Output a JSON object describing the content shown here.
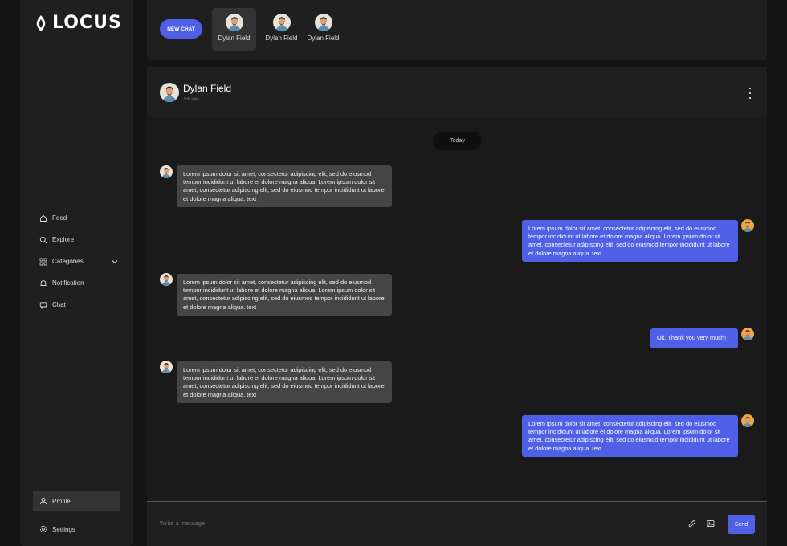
{
  "brand": {
    "name": "LOCUS"
  },
  "sidebar": {
    "items": [
      {
        "label": "Feed",
        "icon": "home-icon"
      },
      {
        "label": "Explore",
        "icon": "search-icon"
      },
      {
        "label": "Categories",
        "icon": "grid-icon"
      },
      {
        "label": "Notification",
        "icon": "bell-icon"
      },
      {
        "label": "Chat",
        "icon": "chat-icon"
      }
    ],
    "profile": "Profile",
    "settings": "Settings"
  },
  "topbar": {
    "new_chat": "NEW CHAT",
    "contacts": [
      "Dylan Field",
      "Dylan Field",
      "Dylan Field"
    ]
  },
  "chat": {
    "name": "Dylan Field",
    "role": "Job role",
    "date_divider": "Today",
    "messages": [
      {
        "side": "in",
        "text": "Lorem ipsum dolor sit amet, consectetur adipiscing elit, sed do eiusmod tempor incididunt ut labore et dolore magna aliqua. Lorem ipsum dolor sit amet, consectetur adipiscing elit, sed do eiusmod tempor incididunt ut labore et dolore magna aliqua. text"
      },
      {
        "side": "out",
        "text": "Lorem ipsum dolor sit amet, consectetur adipiscing elit, sed do eiusmod tempor incididunt ut labore et dolore magna aliqua. Lorem ipsum dolor sit amet, consectetur adipiscing elit, sed do eiusmod tempor incididunt ut labore et dolore magna aliqua. text"
      },
      {
        "side": "in",
        "text": "Lorem ipsum dolor sit amet, consectetur adipiscing elit, sed do eiusmod tempor incididunt ut labore et dolore magna aliqua. Lorem ipsum dolor sit amet, consectetur adipiscing elit, sed do eiusmod tempor incididunt ut labore et dolore magna aliqua. text"
      },
      {
        "side": "out",
        "text": "Ok. Thank you very much!"
      },
      {
        "side": "in",
        "text": "Lorem ipsum dolor sit amet, consectetur adipiscing elit, sed do eiusmod tempor incididunt ut labore et dolore magna aliqua. Lorem ipsum dolor sit amet, consectetur adipiscing elit, sed do eiusmod tempor incididunt ut labore et dolore magna aliqua. text"
      },
      {
        "side": "out",
        "text": "Lorem ipsum dolor sit amet, consectetur adipiscing elit, sed do eiusmod tempor incididunt ut labore et dolore magna aliqua. Lorem ipsum dolor sit amet, consectetur adipiscing elit, sed do eiusmod tempor incididunt ut labore et dolore magna aliqua. text"
      }
    ],
    "composer_placeholder": "Write a message",
    "send_label": "Send"
  },
  "colors": {
    "accent": "#4f5fe6",
    "panel": "#1f1f1f",
    "incoming": "#454545"
  }
}
